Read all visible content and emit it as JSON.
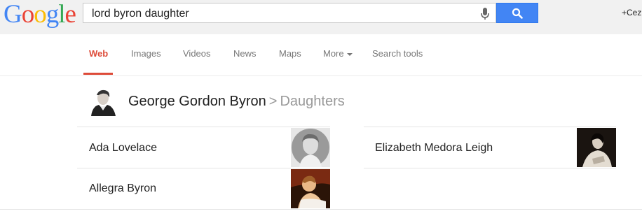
{
  "logo": {
    "letters": [
      "G",
      "o",
      "o",
      "g",
      "l",
      "e"
    ],
    "colors": [
      "#4285f4",
      "#ea4335",
      "#fbbc05",
      "#4285f4",
      "#34a853",
      "#ea4335"
    ]
  },
  "search": {
    "query": "lord byron daughter"
  },
  "user": {
    "label": "+Cez"
  },
  "tabs": [
    {
      "label": "Web",
      "active": true
    },
    {
      "label": "Images"
    },
    {
      "label": "Videos"
    },
    {
      "label": "News"
    },
    {
      "label": "Maps"
    },
    {
      "label": "More"
    },
    {
      "label": "Search tools"
    }
  ],
  "knowledge": {
    "entity": "George Gordon Byron",
    "separator": ">",
    "relation": "Daughters",
    "items": [
      {
        "name": "Ada Lovelace",
        "image": "ada-lovelace-portrait"
      },
      {
        "name": "Elizabeth Medora Leigh",
        "image": "elizabeth-medora-leigh-portrait"
      },
      {
        "name": "Allegra Byron",
        "image": "allegra-byron-portrait"
      }
    ]
  },
  "colors": {
    "accent_red": "#dd4b39",
    "search_blue": "#4285f4"
  }
}
